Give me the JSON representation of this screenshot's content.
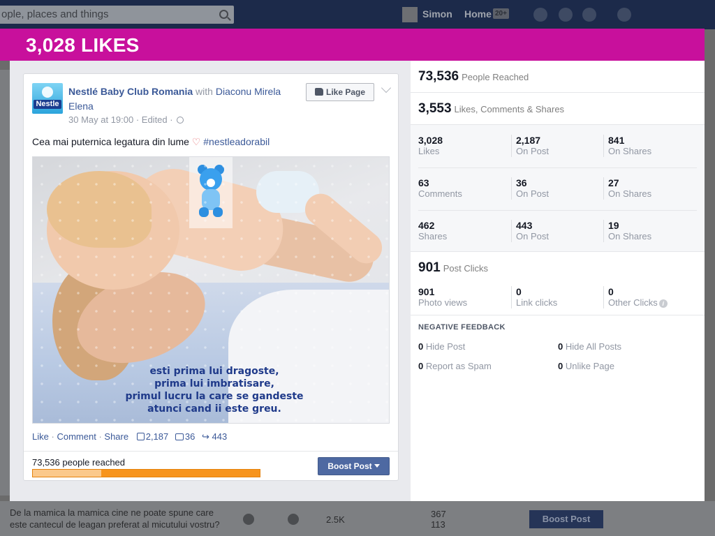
{
  "background": {
    "search_placeholder": "ople, places and things",
    "user_name": "Simon",
    "home_label": "Home",
    "home_badge": "20+",
    "bottom_text": "De la mamica la mamica cine ne poate spune care este cantecul de leagan preferat al micutului vostru?",
    "bottom_reach": "2.5K",
    "bottom_num1": "367",
    "bottom_num2": "113",
    "bottom_boost": "Boost Post"
  },
  "modal": {
    "title": "3,028 LIKES"
  },
  "post": {
    "page_name": "Nestlé Baby Club Romania",
    "with_text": "with",
    "tagged": "Diaconu Mirela Elena",
    "logo_text": "Nestle",
    "meta": "30 May at 19:00 · Edited ·",
    "like_page_label": "Like Page",
    "text": "Cea mai puternica legatura din lume",
    "hashtag": "#nestleadorabil",
    "photo_caption": [
      "esti prima lui dragoste,",
      "prima lui imbratisare,",
      "primul lucru la care se gandeste",
      "atunci cand ii este greu."
    ],
    "actions": {
      "like": "Like",
      "comment": "Comment",
      "share": "Share",
      "likes_count": "2,187",
      "comments_count": "36",
      "shares_count": "443"
    },
    "reached_text": "73,536 people reached",
    "reach_bar_fraction": 0.3,
    "boost_label": "Boost Post"
  },
  "stats": {
    "reached": {
      "value": "73,536",
      "label": "People Reached"
    },
    "engagement": {
      "value": "3,553",
      "label": "Likes, Comments & Shares"
    },
    "likes": [
      {
        "value": "3,028",
        "label": "Likes"
      },
      {
        "value": "2,187",
        "label": "On Post"
      },
      {
        "value": "841",
        "label": "On Shares"
      }
    ],
    "comments": [
      {
        "value": "63",
        "label": "Comments"
      },
      {
        "value": "36",
        "label": "On Post"
      },
      {
        "value": "27",
        "label": "On Shares"
      }
    ],
    "shares": [
      {
        "value": "462",
        "label": "Shares"
      },
      {
        "value": "443",
        "label": "On Post"
      },
      {
        "value": "19",
        "label": "On Shares"
      }
    ],
    "post_clicks": {
      "value": "901",
      "label": "Post Clicks"
    },
    "clicks": [
      {
        "value": "901",
        "label": "Photo views"
      },
      {
        "value": "0",
        "label": "Link clicks"
      },
      {
        "value": "0",
        "label": "Other Clicks"
      }
    ],
    "negative_title": "NEGATIVE FEEDBACK",
    "negative": [
      {
        "value": "0",
        "label": "Hide Post"
      },
      {
        "value": "0",
        "label": "Hide All Posts"
      },
      {
        "value": "0",
        "label": "Report as Spam"
      },
      {
        "value": "0",
        "label": "Unlike Page"
      }
    ]
  },
  "colors": {
    "header": "#c8109c",
    "link": "#3b5998",
    "boost": "#4e69a2",
    "reach_bar": "#f7941d"
  }
}
